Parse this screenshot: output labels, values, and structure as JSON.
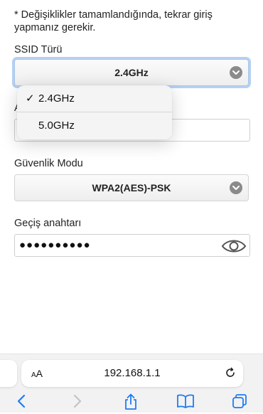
{
  "note": "* Değişiklikler tamamlandığında, tekrar giriş yapmanız gerekir.",
  "ssid_type": {
    "label": "SSID Türü",
    "value": "2.4GHz"
  },
  "dropdown": {
    "options": [
      {
        "label": "2.4GHz",
        "selected": true
      },
      {
        "label": "5.0GHz",
        "selected": false
      }
    ]
  },
  "hidden_label_initial": "A",
  "security": {
    "label": "Güvenlik Modu",
    "value": "WPA2(AES)-PSK"
  },
  "passkey": {
    "label": "Geçiş anahtarı",
    "value": "●●●●●●●●●●"
  },
  "browser": {
    "aa_label": "AA",
    "url": "192.168.1.1"
  },
  "icons": {
    "chevron": "chevron-down-icon",
    "eye": "eye-icon",
    "reload": "reload-icon",
    "back": "back-icon",
    "forward": "forward-icon",
    "share": "share-icon",
    "bookmarks": "bookmarks-icon",
    "tabs": "tabs-icon"
  },
  "colors": {
    "accent": "#1e7cf2",
    "focus_ring": "#78aae6"
  }
}
